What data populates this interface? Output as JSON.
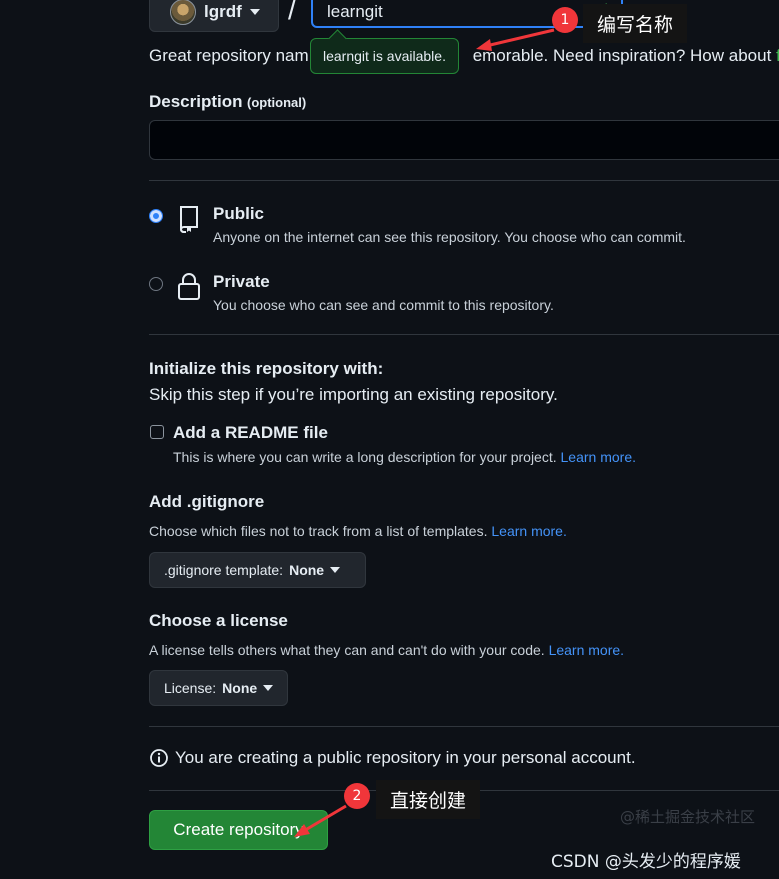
{
  "owner": {
    "name": "lgrdf"
  },
  "repo_name": {
    "value": "learngit"
  },
  "availability": {
    "hint_prefix": "Great repository nam",
    "hint_suffix": "emorable. Need inspiration? How about ",
    "hint_link": "fr",
    "tooltip": "learngit is available."
  },
  "description": {
    "label": "Description",
    "optional": "(optional)",
    "value": ""
  },
  "visibility": [
    {
      "title": "Public",
      "desc": "Anyone on the internet can see this repository. You choose who can commit.",
      "selected": true,
      "icon": "repo-icon"
    },
    {
      "title": "Private",
      "desc": "You choose who can see and commit to this repository.",
      "selected": false,
      "icon": "lock-icon"
    }
  ],
  "initialize": {
    "title": "Initialize this repository with:",
    "subtitle": "Skip this step if you’re importing an existing repository.",
    "readme_label": "Add a README file",
    "readme_desc": "This is where you can write a long description for your project.",
    "readme_link": "Learn more.",
    "readme_checked": false
  },
  "gitignore": {
    "title": "Add .gitignore",
    "desc": "Choose which files not to track from a list of templates.",
    "link": "Learn more.",
    "select_prefix": ".gitignore template:",
    "select_value": "None"
  },
  "license": {
    "title": "Choose a license",
    "desc": "A license tells others what they can and can't do with your code.",
    "link": "Learn more.",
    "select_prefix": "License:",
    "select_value": "None"
  },
  "notice": {
    "text": "You are creating a public repository in your personal account.",
    "icon": "info-icon"
  },
  "create_button": {
    "label": "Create repository"
  },
  "annotations": [
    {
      "number": "1",
      "label": "编写名称"
    },
    {
      "number": "2",
      "label": "直接创建"
    }
  ],
  "watermarks": {
    "primary": "CSDN @头发少的程序媛",
    "secondary": "@稀土掘金技术社区"
  },
  "colors": {
    "accent": "#2f81f7",
    "success": "#238636",
    "link": "#4493f8",
    "annotation": "#f0363a",
    "background": "#0d1117"
  }
}
